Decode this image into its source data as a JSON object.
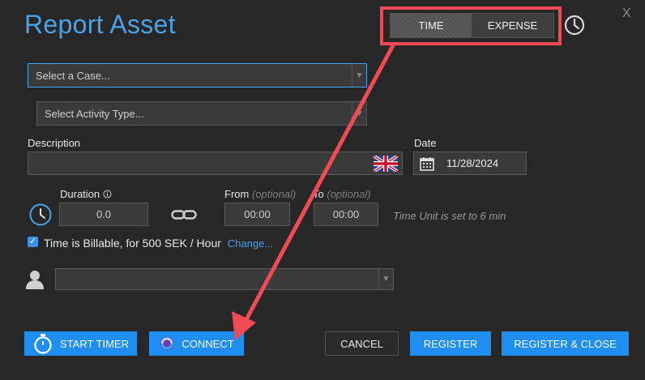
{
  "window": {
    "title": "Report Asset",
    "close_label": "X"
  },
  "mode_toggle": {
    "time_label": "TIME",
    "expense_label": "EXPENSE"
  },
  "case_select": {
    "placeholder": "Select a Case..."
  },
  "activity_select": {
    "placeholder": "Select Activity Type..."
  },
  "description": {
    "label": "Description",
    "value": ""
  },
  "date": {
    "label": "Date",
    "value": "11/28/2024"
  },
  "duration": {
    "label": "Duration",
    "value": "0.0"
  },
  "from": {
    "label": "From",
    "optional": "(optional)",
    "value": "00:00"
  },
  "to": {
    "label": "To",
    "optional": "(optional)",
    "value": "00:00"
  },
  "time_unit_note": "Time Unit is set to 6 min",
  "billable": {
    "checked": true,
    "label": "Time is Billable, for 500 SEK / Hour",
    "change_link": "Change..."
  },
  "user_select": {
    "value": ""
  },
  "buttons": {
    "start_timer": "START TIMER",
    "connect": "CONNECT",
    "cancel": "CANCEL",
    "register": "REGISTER",
    "register_close": "REGISTER & CLOSE"
  },
  "colors": {
    "accent": "#4aa3e8",
    "primary_button": "#1e8ef0",
    "annotation": "#f04a55",
    "background": "#272727"
  }
}
